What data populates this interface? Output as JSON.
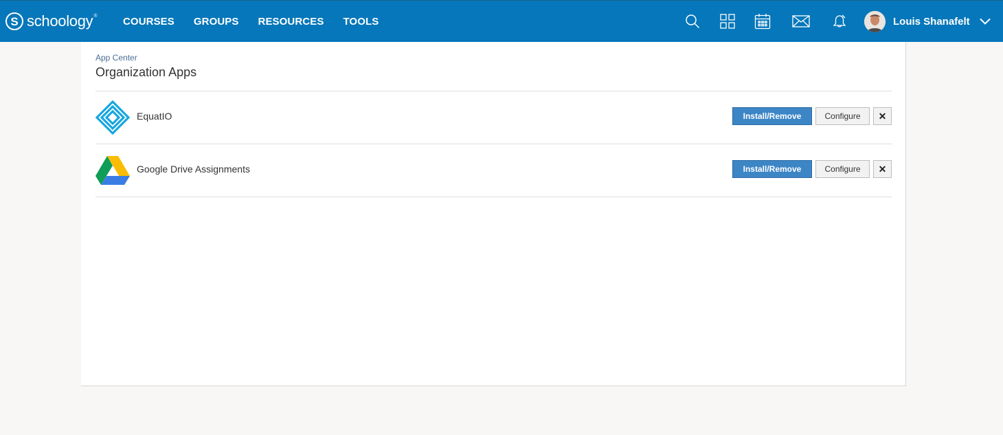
{
  "header": {
    "logo_letter": "S",
    "logo_text": "schoology",
    "logo_tm": "®",
    "nav": [
      "COURSES",
      "GROUPS",
      "RESOURCES",
      "TOOLS"
    ],
    "icons": [
      "search-icon",
      "apps-grid-icon",
      "calendar-icon",
      "mail-icon",
      "notifications-icon"
    ],
    "user_name": "Louis Shanafelt",
    "brand_color": "#0677ba"
  },
  "page": {
    "breadcrumb": "App Center",
    "title": "Organization Apps"
  },
  "apps": [
    {
      "name": "EquatIO",
      "icon": "equatio-logo-icon",
      "install_label": "Install/Remove",
      "configure_label": "Configure",
      "close_label": "✕"
    },
    {
      "name": "Google Drive Assignments",
      "icon": "google-drive-logo-icon",
      "install_label": "Install/Remove",
      "configure_label": "Configure",
      "close_label": "✕"
    }
  ]
}
